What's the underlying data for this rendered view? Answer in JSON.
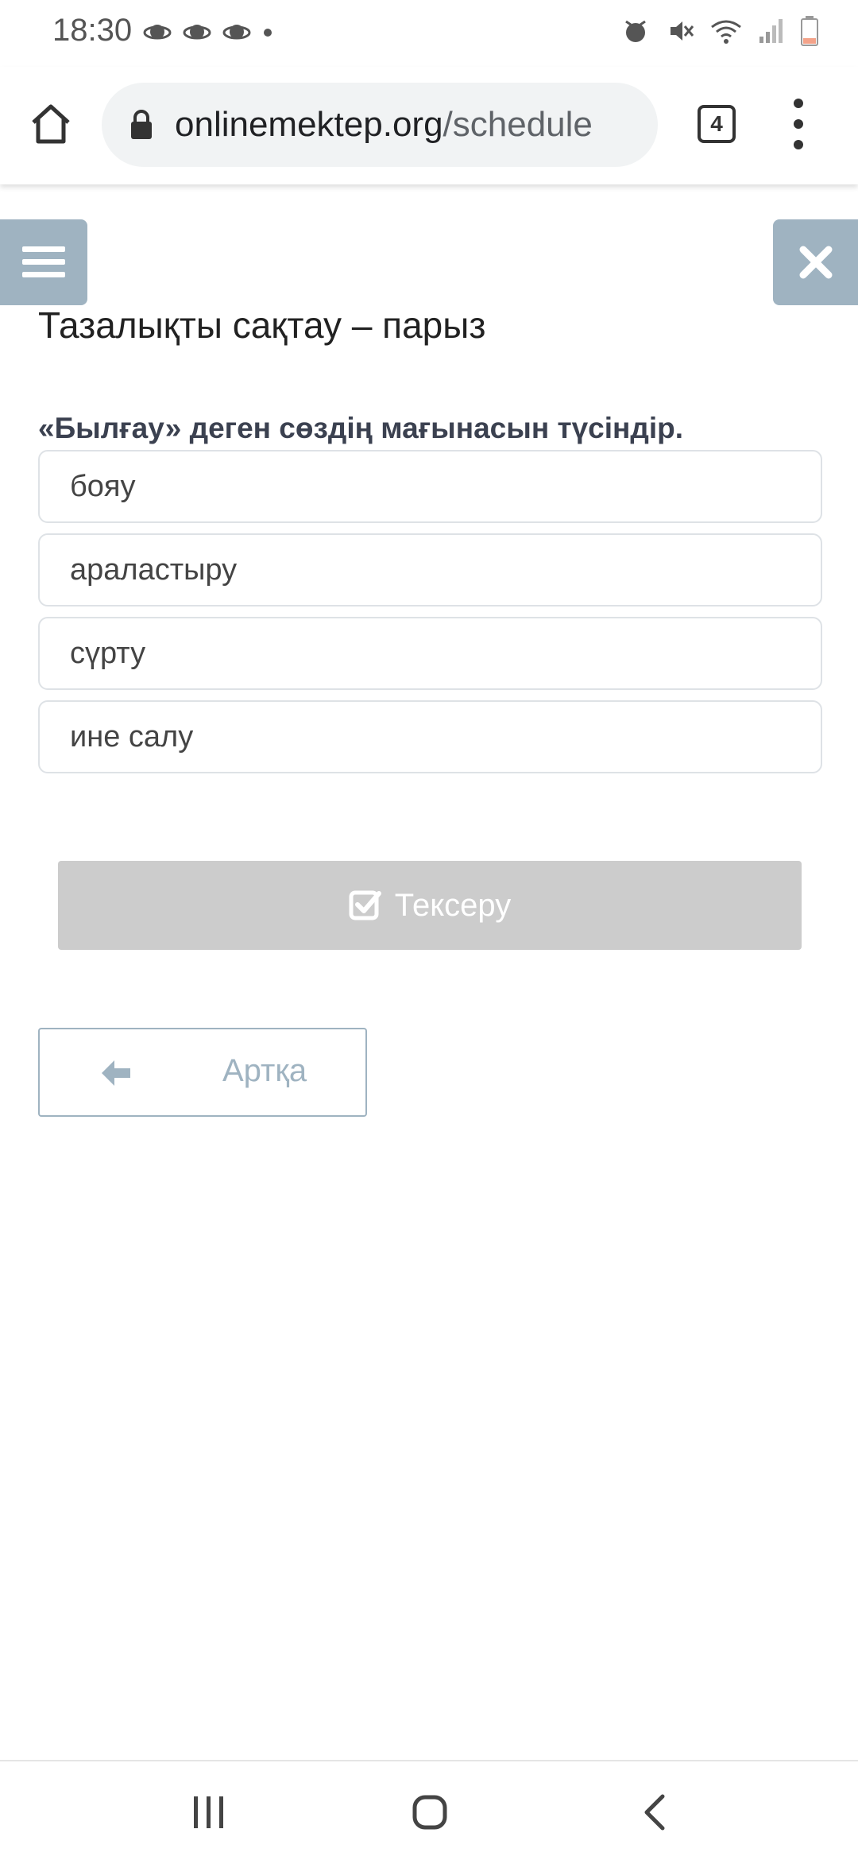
{
  "status_bar": {
    "time": "18:30"
  },
  "browser": {
    "url_domain": "onlinemektep.org",
    "url_path": "/schedule",
    "tab_count": "4"
  },
  "lesson": {
    "title": "Тазалықты сақтау – парыз"
  },
  "quiz": {
    "question": "«Былғау» деген сөздің мағынасын түсіндір.",
    "options": [
      "бояу",
      "араластыру",
      "сүрту",
      "ине салу"
    ],
    "check_label": "Тексеру",
    "back_label": "Артқа"
  },
  "colors": {
    "accent": "#9fb3c1",
    "disabled_button": "#cccccc"
  },
  "icons": {
    "side_menu": "hamburger-icon",
    "close": "close-icon",
    "check": "checkbox-icon",
    "back": "arrow-left-icon"
  }
}
